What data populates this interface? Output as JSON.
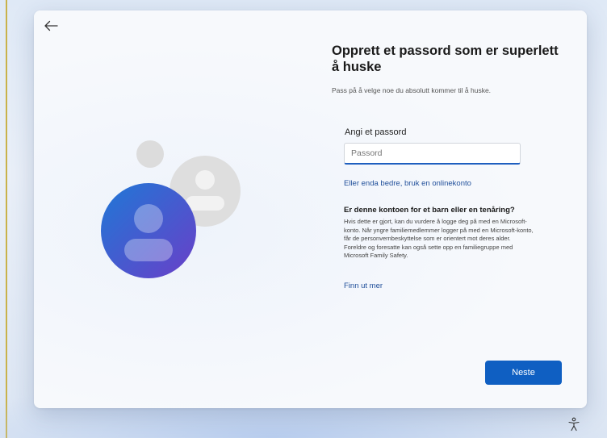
{
  "page": {
    "title": "Opprett et passord som er superlett å huske",
    "subtitle": "Pass på å velge noe du absolutt kommer til å huske."
  },
  "password": {
    "label": "Angi et passord",
    "placeholder": "Passord",
    "value": ""
  },
  "links": {
    "online_account": "Eller enda bedre, bruk en onlinekonto",
    "learn_more": "Finn ut mer"
  },
  "child_section": {
    "heading": "Er denne kontoen for et barn eller en tenåring?",
    "body": "Hvis dette er gjort, kan du vurdere å logge deg på med en Microsoft-konto. Når yngre familiemedlemmer logger på med en Microsoft-konto, får de personvernbeskyttelse som er orientert mot deres alder. Foreldre og foresatte kan også sette opp en familiegruppe med Microsoft Family Safety."
  },
  "buttons": {
    "next": "Neste"
  },
  "icons": {
    "back": "back-arrow-icon",
    "accessibility": "accessibility-icon",
    "illustration": "user-accounts-illustration"
  },
  "colors": {
    "accent": "#0f5fc2",
    "link": "#1f4e9a",
    "avatar_gradient_start": "#1f78d6",
    "avatar_gradient_end": "#6a3fc8"
  }
}
